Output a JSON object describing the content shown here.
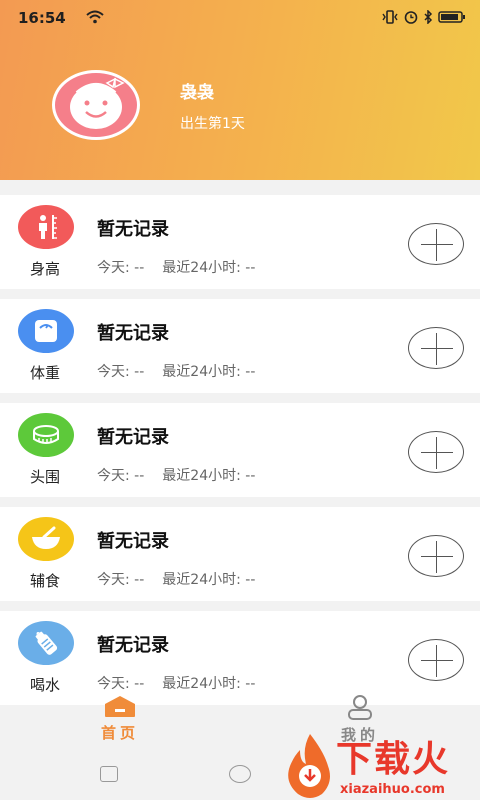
{
  "status_bar": {
    "time": "16:54"
  },
  "profile": {
    "name": "袅袅",
    "age_text": "出生第1天"
  },
  "records": [
    {
      "label": "身高",
      "icon": "height-icon",
      "color": "#f25a5a",
      "title": "暂无记录",
      "today": "今天: --",
      "recent": "最近24小时: --"
    },
    {
      "label": "体重",
      "icon": "scale-icon",
      "color": "#4a8ff0",
      "title": "暂无记录",
      "today": "今天: --",
      "recent": "最近24小时: --"
    },
    {
      "label": "头围",
      "icon": "tape-measure-icon",
      "color": "#5dc93a",
      "title": "暂无记录",
      "today": "今天: --",
      "recent": "最近24小时: --"
    },
    {
      "label": "辅食",
      "icon": "bowl-icon",
      "color": "#f5c518",
      "title": "暂无记录",
      "today": "今天: --",
      "recent": "最近24小时: --"
    },
    {
      "label": "喝水",
      "icon": "bottle-icon",
      "color": "#6aaee8",
      "title": "暂无记录",
      "today": "今天: --",
      "recent": "最近24小时: --"
    }
  ],
  "tabs": {
    "home": "首页",
    "mine": "我的"
  },
  "watermark": {
    "text": "下载火",
    "url": "xiazaihuo.com"
  },
  "colors": {
    "accent": "#f08c3a",
    "header_start": "#f39a52",
    "header_end": "#f1c84a"
  }
}
